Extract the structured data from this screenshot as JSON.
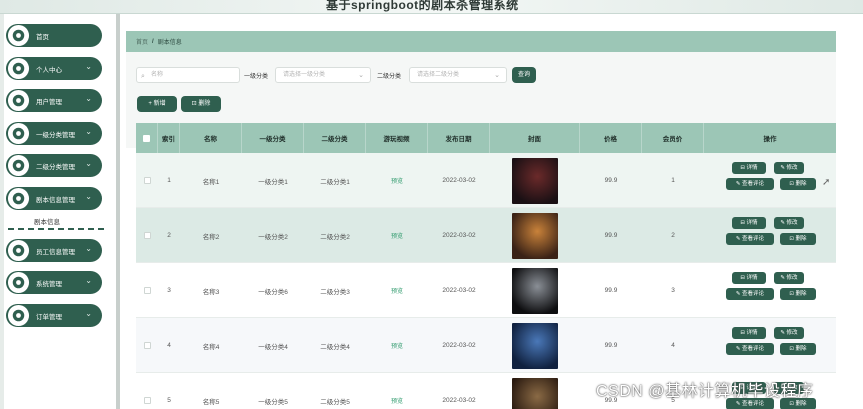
{
  "header": {
    "title": "基于springboot的剧本杀管理系统"
  },
  "sidebar": {
    "items": [
      {
        "label": "首页",
        "has_arrow": false
      },
      {
        "label": "个人中心",
        "has_arrow": true
      },
      {
        "label": "用户管理",
        "has_arrow": true
      },
      {
        "label": "一级分类管理",
        "has_arrow": true
      },
      {
        "label": "二级分类管理",
        "has_arrow": true
      },
      {
        "label": "剧本信息管理",
        "has_arrow": true
      },
      {
        "label": "员工信息管理",
        "has_arrow": true
      },
      {
        "label": "系统管理",
        "has_arrow": true
      },
      {
        "label": "订单管理",
        "has_arrow": true
      }
    ],
    "submenu_label": "剧本信息",
    "arrow": "⌄"
  },
  "breadcrumb": {
    "home": "首页",
    "sep": "/",
    "current": "剧本信息"
  },
  "search": {
    "name_placeholder": "名称",
    "cat1_label": "一级分类",
    "cat1_placeholder": "请选择一级分类",
    "cat2_label": "二级分类",
    "cat2_placeholder": "请选择二级分类",
    "query_label": "查询",
    "search_icon": "⌕",
    "select_icon": "⌄"
  },
  "toolbar": {
    "add_label": "+ 新增",
    "delete_label": "⊡ 删除"
  },
  "table": {
    "columns": [
      "索引",
      "名称",
      "一级分类",
      "二级分类",
      "游玩视频",
      "发布日期",
      "封面",
      "价格",
      "会员价",
      "操作"
    ],
    "rows": [
      {
        "index": "1",
        "name": "名称1",
        "cat1": "一级分类1",
        "cat2": "二级分类1",
        "video": "预览",
        "date": "2022-03-02",
        "price": "99.9",
        "vip": "1"
      },
      {
        "index": "2",
        "name": "名称2",
        "cat1": "一级分类2",
        "cat2": "二级分类2",
        "video": "预览",
        "date": "2022-03-02",
        "price": "99.9",
        "vip": "2"
      },
      {
        "index": "3",
        "name": "名称3",
        "cat1": "一级分类6",
        "cat2": "二级分类3",
        "video": "预览",
        "date": "2022-03-02",
        "price": "99.9",
        "vip": "3"
      },
      {
        "index": "4",
        "name": "名称4",
        "cat1": "一级分类4",
        "cat2": "二级分类4",
        "video": "预览",
        "date": "2022-03-02",
        "price": "99.9",
        "vip": "4"
      },
      {
        "index": "5",
        "name": "名称5",
        "cat1": "一级分类5",
        "cat2": "二级分类5",
        "video": "预览",
        "date": "2022-03-02",
        "price": "99.9",
        "vip": "5"
      }
    ],
    "ops": {
      "detail": "⊟ 详情",
      "edit": "✎ 修改",
      "comment": "✎ 查看评论",
      "delete": "⊡ 删除"
    }
  },
  "watermark": "CSDN @基林计算机毕设程序",
  "colors": {
    "accent": "#2f5f4f",
    "header_bg": "#9cc6b6"
  }
}
